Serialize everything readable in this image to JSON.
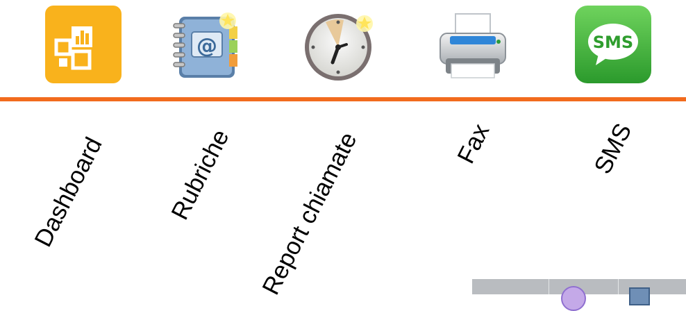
{
  "nav": {
    "items": [
      {
        "id": "dashboard",
        "label": "Dashboard",
        "icon": "dashboard-icon"
      },
      {
        "id": "rubriche",
        "label": "Rubriche",
        "icon": "address-book-icon"
      },
      {
        "id": "report-chiamate",
        "label": "Report chiamate",
        "icon": "clock-icon"
      },
      {
        "id": "fax",
        "label": "Fax",
        "icon": "printer-icon"
      },
      {
        "id": "sms",
        "label": "SMS",
        "icon": "sms-icon"
      }
    ],
    "divider_color": "#f26b1d"
  },
  "sms_icon_text": "SMS",
  "colors": {
    "dashboard_bg": "#f9b21c",
    "sms_bg": "#3fad3a",
    "accent": "#f26b1d"
  }
}
